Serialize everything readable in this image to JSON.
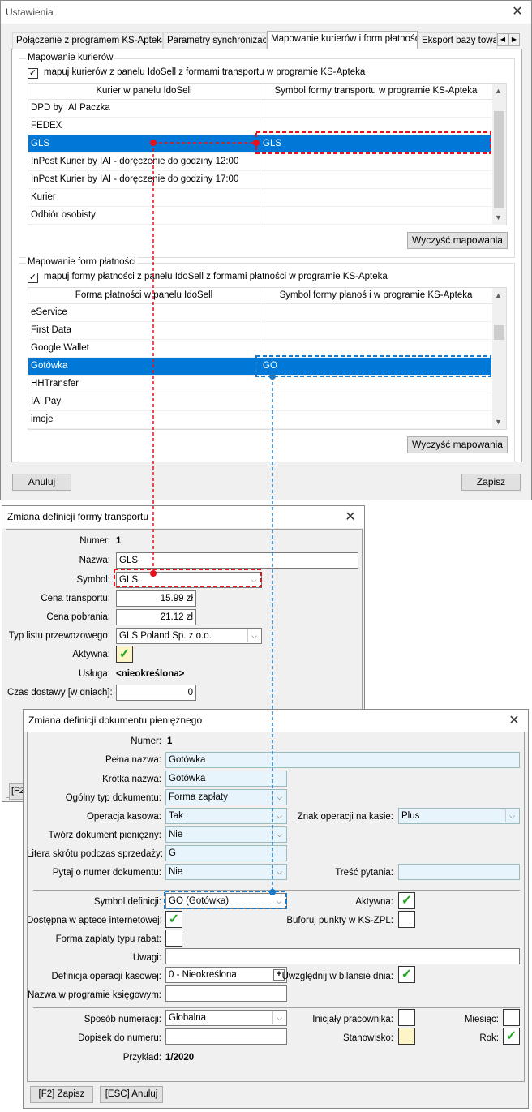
{
  "settings": {
    "title": "Ustawienia",
    "tabs": [
      "Połączenie z programem KS-Apteka",
      "Parametry synchronizacji",
      "Mapowanie kurierów i form płatności",
      "Eksport bazy towar"
    ],
    "couriers": {
      "group_label": "Mapowanie kurierów",
      "checkbox_label": "mapuj kurierów z panelu IdoSell z formami transportu w programie KS-Apteka",
      "columns": [
        "Kurier w panelu IdoSell",
        "Symbol formy transportu w programie KS-Apteka"
      ],
      "rows": [
        {
          "name": "DPD by IAI Paczka",
          "symbol": ""
        },
        {
          "name": "FEDEX",
          "symbol": ""
        },
        {
          "name": "GLS",
          "symbol": "GLS"
        },
        {
          "name": "InPost Kurier by IAI - doręczenie do godziny 12:00",
          "symbol": ""
        },
        {
          "name": "InPost Kurier by IAI - doręczenie do godziny 17:00",
          "symbol": ""
        },
        {
          "name": "Kurier",
          "symbol": ""
        },
        {
          "name": "Odbiór osobisty",
          "symbol": ""
        }
      ],
      "clear_button": "Wyczyść mapowania"
    },
    "payments": {
      "group_label": "Mapowanie form płatności",
      "checkbox_label": "mapuj formy płatności z panelu IdoSell z formami płatności w programie KS-Apteka",
      "columns": [
        "Forma płatności w panelu IdoSell",
        "Symbol formy płanoś i w programie KS-Apteka"
      ],
      "rows": [
        {
          "name": "eService",
          "symbol": ""
        },
        {
          "name": "First Data",
          "symbol": ""
        },
        {
          "name": "Google Wallet",
          "symbol": ""
        },
        {
          "name": "Gotówka",
          "symbol": "GO"
        },
        {
          "name": "HHTransfer",
          "symbol": ""
        },
        {
          "name": "IAI Pay",
          "symbol": ""
        },
        {
          "name": "imoje",
          "symbol": ""
        }
      ],
      "clear_button": "Wyczyść mapowania"
    },
    "cancel_button": "Anuluj",
    "save_button": "Zapisz"
  },
  "transport": {
    "title": "Zmiana definicji formy transportu",
    "labels": {
      "number": "Numer:",
      "name": "Nazwa:",
      "symbol": "Symbol:",
      "price": "Cena transportu:",
      "cod": "Cena pobrania:",
      "letter": "Typ listu przewozowego:",
      "active": "Aktywna:",
      "service": "Usługa:",
      "time": "Czas dostawy [w dniach]:"
    },
    "values": {
      "number": "1",
      "name": "GLS",
      "symbol": "GLS",
      "price": "15.99 zł",
      "cod": "21.12 zł",
      "letter": "GLS Poland Sp. z o.o.",
      "service": "<nieokreślona>",
      "time": "0"
    },
    "footer_button": "[F2"
  },
  "document": {
    "title": "Zmiana definicji dokumentu pieniężnego",
    "labels": {
      "number": "Numer:",
      "full_name": "Pełna nazwa:",
      "short_name": "Krótka nazwa:",
      "doc_type": "Ogólny typ dokumentu:",
      "cash_op": "Operacja kasowa:",
      "cash_sign": "Znak operacji na kasie:",
      "create_doc": "Twórz dokument pieniężny:",
      "letter": "Litera skrótu podczas sprzedaży:",
      "ask_number": "Pytaj o numer dokumentu:",
      "question": "Treść pytania:",
      "symbol": "Symbol definicji:",
      "active": "Aktywna:",
      "online": "Dostępna w aptece internetowej:",
      "buffer": "Buforuj punkty w KS-ZPL:",
      "discount": "Forma zapłaty typu rabat:",
      "notes": "Uwagi:",
      "cash_def": "Definicja operacji kasowej:",
      "balance": "Uwzględnij w bilansie dnia:",
      "accounting": "Nazwa w programie księgowym:",
      "numbering": "Sposób numeracji:",
      "initials": "Inicjały pracownika:",
      "month": "Miesiąc:",
      "suffix": "Dopisek do numeru:",
      "station": "Stanowisko:",
      "year": "Rok:",
      "example": "Przykład:"
    },
    "values": {
      "number": "1",
      "full_name": "Gotówka",
      "short_name": "Gotówka",
      "doc_type": "Forma zapłaty",
      "cash_op": "Tak",
      "cash_sign": "Plus",
      "create_doc": "Nie",
      "letter": "G",
      "ask_number": "Nie",
      "symbol": "GO (Gotówka)",
      "cash_def": "0 - Nieokreślona",
      "numbering": "Globalna",
      "example": "1/2020"
    },
    "save_button": "[F2] Zapisz",
    "cancel_button": "[ESC] Anuluj"
  },
  "colors": {
    "selection": "#0078d7",
    "red_highlight": "#e8101a",
    "blue_highlight": "#1a7ac8",
    "check_green": "#22a622"
  }
}
